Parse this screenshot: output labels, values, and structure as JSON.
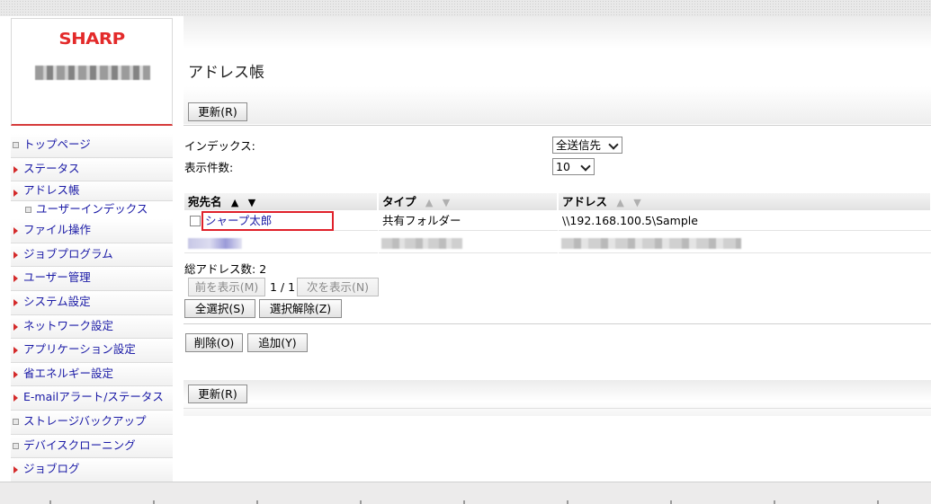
{
  "brand": "SHARP",
  "nav": {
    "items": [
      {
        "label": "トップページ",
        "marker": "square",
        "sub": false
      },
      {
        "label": "ステータス",
        "marker": "triangle",
        "sub": false
      },
      {
        "label": "アドレス帳",
        "marker": "triangle",
        "sub": false
      },
      {
        "label": "ユーザーインデックス",
        "marker": "square",
        "sub": true
      },
      {
        "label": "ファイル操作",
        "marker": "triangle",
        "sub": false
      },
      {
        "label": "ジョブプログラム",
        "marker": "triangle",
        "sub": false
      },
      {
        "label": "ユーザー管理",
        "marker": "triangle",
        "sub": false
      },
      {
        "label": "システム設定",
        "marker": "triangle",
        "sub": false
      },
      {
        "label": "ネットワーク設定",
        "marker": "triangle",
        "sub": false
      },
      {
        "label": "アプリケーション設定",
        "marker": "triangle",
        "sub": false
      },
      {
        "label": "省エネルギー設定",
        "marker": "triangle",
        "sub": false
      },
      {
        "label": "E-mailアラート/ステータス",
        "marker": "triangle",
        "sub": false
      },
      {
        "label": "ストレージバックアップ",
        "marker": "square",
        "sub": false
      },
      {
        "label": "デバイスクローニング",
        "marker": "square",
        "sub": false
      },
      {
        "label": "ジョブログ",
        "marker": "triangle",
        "sub": false
      }
    ]
  },
  "page": {
    "title": "アドレス帳",
    "refresh_label": "更新(R)",
    "index_label": "インデックス:",
    "index_value": "全送信先",
    "count_label": "表示件数:",
    "count_value": "10"
  },
  "table": {
    "headers": [
      "宛先名",
      "タイプ",
      "アドレス"
    ],
    "sort_primary": "▲",
    "sort_filter": "▼",
    "sort_dim": "▲",
    "rows": [
      {
        "name": "シャープ太郎",
        "type": "共有フォルダー",
        "address": "\\\\192.168.100.5\\Sample"
      }
    ]
  },
  "summary": {
    "total_label": "総アドレス数:",
    "total_value": "2"
  },
  "pager": {
    "prev_label": "前を表示(M)",
    "page_text": "1 / 1",
    "next_label": "次を表示(N)"
  },
  "actions": {
    "select_all_label": "全選択(S)",
    "deselect_label": "選択解除(Z)",
    "delete_label": "削除(O)",
    "add_label": "追加(Y)",
    "refresh_bottom_label": "更新(R)"
  },
  "colors": {
    "brand_red": "#e32a2a",
    "link_blue": "#1a1aa6",
    "highlight_red": "#e0202a"
  },
  "icons": {
    "nav_triangle": "caret-right-icon",
    "nav_square": "square-bullet-icon",
    "sort_up": "sort-asc-icon",
    "filter": "filter-icon",
    "dropdown": "chevron-down-icon"
  }
}
